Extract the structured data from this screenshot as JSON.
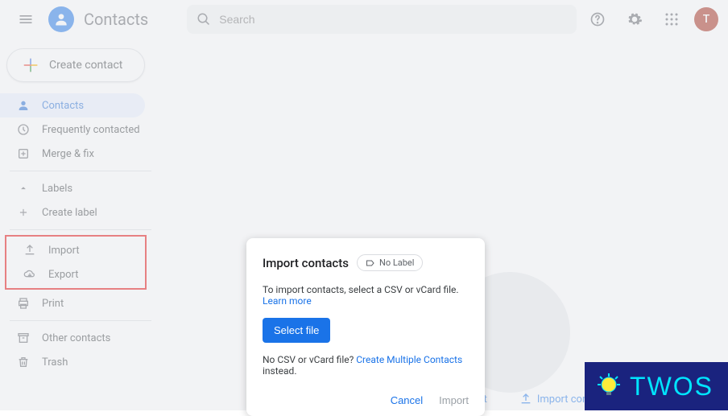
{
  "header": {
    "app_title": "Contacts",
    "search_placeholder": "Search",
    "avatar_initial": "T"
  },
  "sidebar": {
    "create_label": "Create contact",
    "items": [
      {
        "label": "Contacts"
      },
      {
        "label": "Frequently contacted"
      },
      {
        "label": "Merge & fix"
      }
    ],
    "labels_header": "Labels",
    "create_label_label": "Create label",
    "import_label": "Import",
    "export_label": "Export",
    "print_label": "Print",
    "other_contacts_label": "Other contacts",
    "trash_label": "Trash"
  },
  "content": {
    "create_contact_action": "Create contact",
    "import_contacts_action": "Import contacts"
  },
  "dialog": {
    "title": "Import contacts",
    "no_label_chip": "No Label",
    "desc_prefix": "To import contacts, select a CSV or vCard file. ",
    "learn_more": "Learn more",
    "select_file_btn": "Select file",
    "no_csv_prefix": "No CSV or vCard file? ",
    "create_multiple_link": "Create Multiple Contacts",
    "no_csv_suffix": " instead.",
    "cancel_btn": "Cancel",
    "import_btn": "Import"
  },
  "watermark": {
    "text": "TWOS"
  }
}
